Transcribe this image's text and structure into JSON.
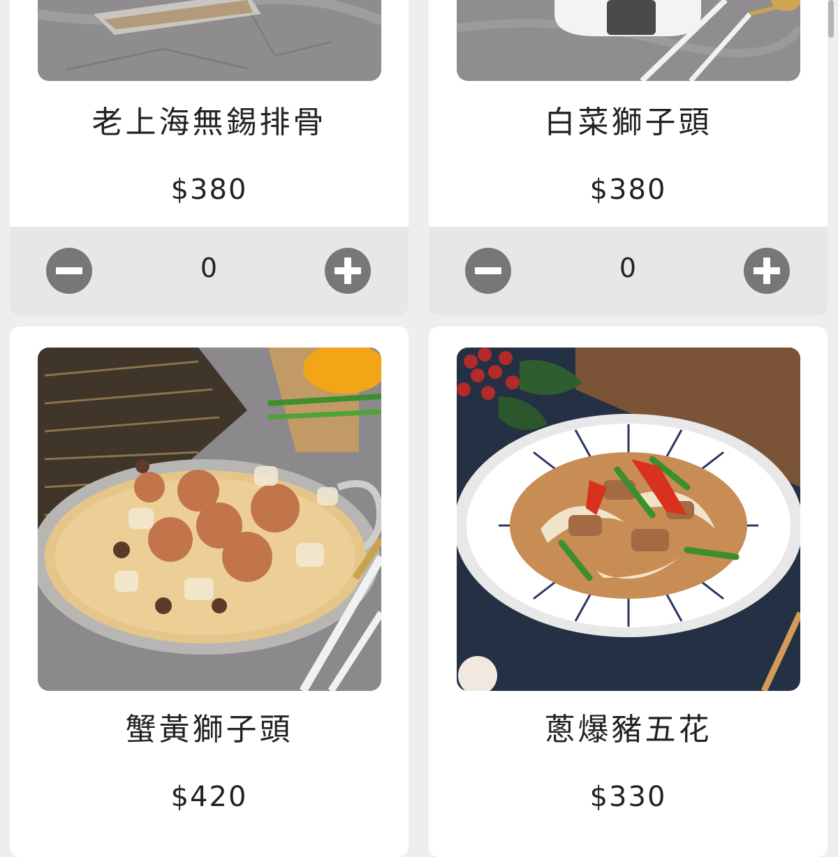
{
  "menu": {
    "items": [
      {
        "name": "老上海無錫排骨",
        "price": "$380",
        "quantity": "0"
      },
      {
        "name": "白菜獅子頭",
        "price": "$380",
        "quantity": "0"
      },
      {
        "name": "蟹黃獅子頭",
        "price": "$420"
      },
      {
        "name": "蔥爆豬五花",
        "price": "$330"
      }
    ]
  },
  "icons": {
    "decrement": "minus-circle-icon",
    "increment": "plus-circle-icon"
  },
  "colors": {
    "page_background": "#eeeeee",
    "card_background": "#ffffff",
    "quantity_bar": "#e7e7e7",
    "stepper_button": "#777777",
    "text": "#222222"
  }
}
